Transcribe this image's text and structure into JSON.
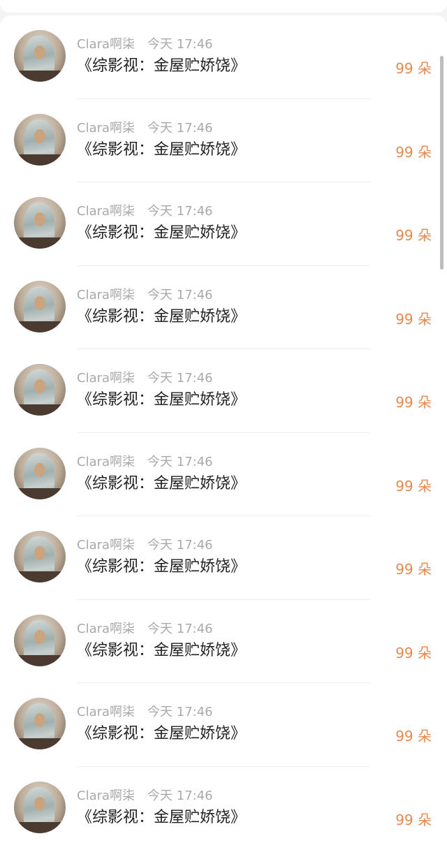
{
  "theme": {
    "accent": "#e8894d",
    "meta_text": "#a9a9a9",
    "title_text": "#222222"
  },
  "list": {
    "items": [
      {
        "user": "Clara啊柒",
        "time": "今天 17:46",
        "title": "《综影视：金屋贮娇饶》",
        "reward": "99 朵"
      },
      {
        "user": "Clara啊柒",
        "time": "今天 17:46",
        "title": "《综影视：金屋贮娇饶》",
        "reward": "99 朵"
      },
      {
        "user": "Clara啊柒",
        "time": "今天 17:46",
        "title": "《综影视：金屋贮娇饶》",
        "reward": "99 朵"
      },
      {
        "user": "Clara啊柒",
        "time": "今天 17:46",
        "title": "《综影视：金屋贮娇饶》",
        "reward": "99 朵"
      },
      {
        "user": "Clara啊柒",
        "time": "今天 17:46",
        "title": "《综影视：金屋贮娇饶》",
        "reward": "99 朵"
      },
      {
        "user": "Clara啊柒",
        "time": "今天 17:46",
        "title": "《综影视：金屋贮娇饶》",
        "reward": "99 朵"
      },
      {
        "user": "Clara啊柒",
        "time": "今天 17:46",
        "title": "《综影视：金屋贮娇饶》",
        "reward": "99 朵"
      },
      {
        "user": "Clara啊柒",
        "time": "今天 17:46",
        "title": "《综影视：金屋贮娇饶》",
        "reward": "99 朵"
      },
      {
        "user": "Clara啊柒",
        "time": "今天 17:46",
        "title": "《综影视：金屋贮娇饶》",
        "reward": "99 朵"
      },
      {
        "user": "Clara啊柒",
        "time": "今天 17:46",
        "title": "《综影视：金屋贮娇饶》",
        "reward": "99 朵"
      }
    ]
  }
}
